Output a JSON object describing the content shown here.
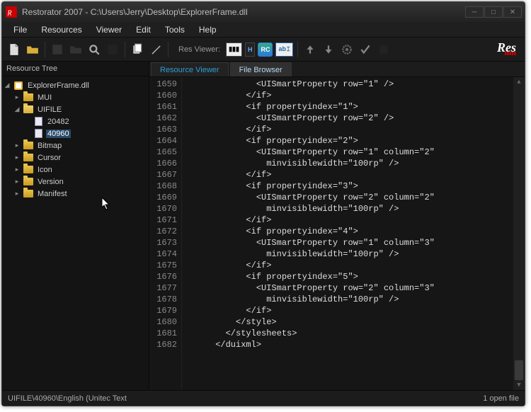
{
  "titlebar": {
    "title": "Restorator 2007 - C:\\Users\\Jerry\\Desktop\\ExplorerFrame.dll"
  },
  "menu": {
    "file": "File",
    "resources": "Resources",
    "viewer": "Viewer",
    "edit": "Edit",
    "tools": "Tools",
    "help": "Help"
  },
  "toolbar": {
    "resviewer_label": "Res Viewer:",
    "logo": "Res"
  },
  "treepane": {
    "title": "Resource Tree"
  },
  "tree": {
    "root": "ExplorerFrame.dll",
    "items": [
      {
        "label": "MUI"
      },
      {
        "label": "UIFILE",
        "open": true,
        "children": [
          {
            "label": "20482"
          },
          {
            "label": "40960",
            "selected": true
          }
        ]
      },
      {
        "label": "Bitmap"
      },
      {
        "label": "Cursor"
      },
      {
        "label": "Icon"
      },
      {
        "label": "Version"
      },
      {
        "label": "Manifest"
      }
    ]
  },
  "tabs": {
    "viewer": "Resource Viewer",
    "browser": "File Browser"
  },
  "code": {
    "start": 1659,
    "lines": [
      "              <UISmartProperty row=\"1\" />",
      "            </if>",
      "            <if propertyindex=\"1\">",
      "              <UISmartProperty row=\"2\" />",
      "            </if>",
      "            <if propertyindex=\"2\">",
      "              <UISmartProperty row=\"1\" column=\"2\"",
      "                minvisiblewidth=\"100rp\" />",
      "            </if>",
      "            <if propertyindex=\"3\">",
      "              <UISmartProperty row=\"2\" column=\"2\"",
      "                minvisiblewidth=\"100rp\" />",
      "            </if>",
      "            <if propertyindex=\"4\">",
      "              <UISmartProperty row=\"1\" column=\"3\"",
      "                minvisiblewidth=\"100rp\" />",
      "            </if>",
      "            <if propertyindex=\"5\">",
      "              <UISmartProperty row=\"2\" column=\"3\"",
      "                minvisiblewidth=\"100rp\" />",
      "            </if>",
      "          </style>",
      "        </stylesheets>",
      "      </duixml>"
    ]
  },
  "status": {
    "left": "UIFILE\\40960\\English (Unitec Text",
    "right": "1 open file"
  }
}
